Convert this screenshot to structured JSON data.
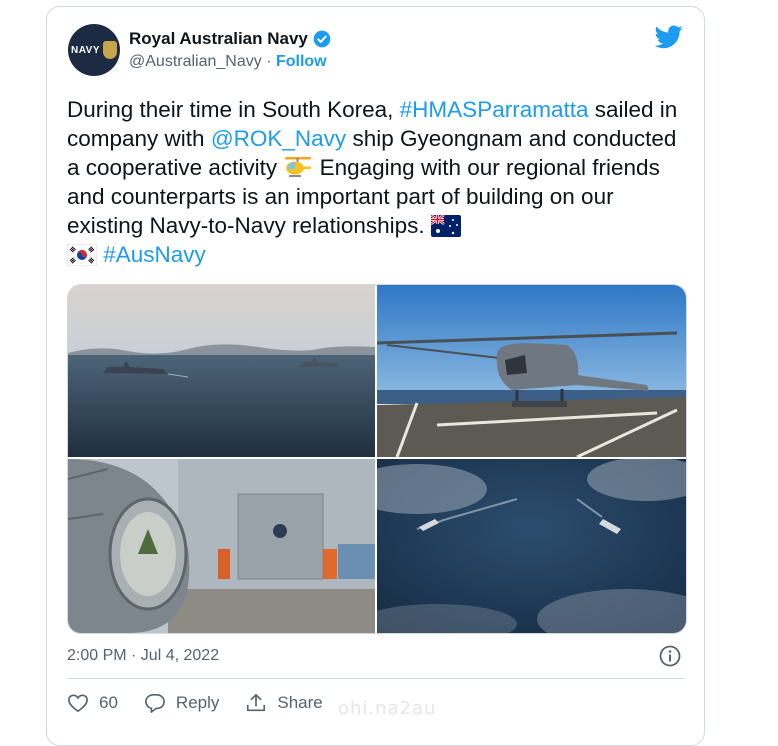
{
  "account": {
    "display_name": "Royal Australian Navy",
    "avatar_text": "NAVY",
    "handle": "@Australian_Navy",
    "separator": " · ",
    "follow_label": "Follow"
  },
  "tweet": {
    "t1": "During their time in South Korea, ",
    "hashtag_parramatta": "#HMASParramatta",
    "t2": " sailed in company with ",
    "mention_roknavy": "@ROK_Navy",
    "t3": " ship Gyeongnam and conducted a cooperative activity ",
    "t4": " Engaging with our regional friends and counterparts is an important part of building on our existing Navy-to-Navy relationships. ",
    "t5": " ",
    "hashtag_ausnavy": "#AusNavy"
  },
  "media": {
    "photos": [
      "ships-sailing-photo",
      "helicopter-on-deck-photo",
      "helicopter-hangar-photo",
      "aerial-ships-photo"
    ]
  },
  "timestamp": "2:00 PM · Jul 4, 2022",
  "actions": {
    "like_count": "60",
    "reply_label": "Reply",
    "share_label": "Share"
  },
  "watermark": "ohi.na2au",
  "colors": {
    "accent": "#1d9bf0",
    "text": "#0f1419",
    "muted": "#536471",
    "border": "#cfd9de"
  }
}
